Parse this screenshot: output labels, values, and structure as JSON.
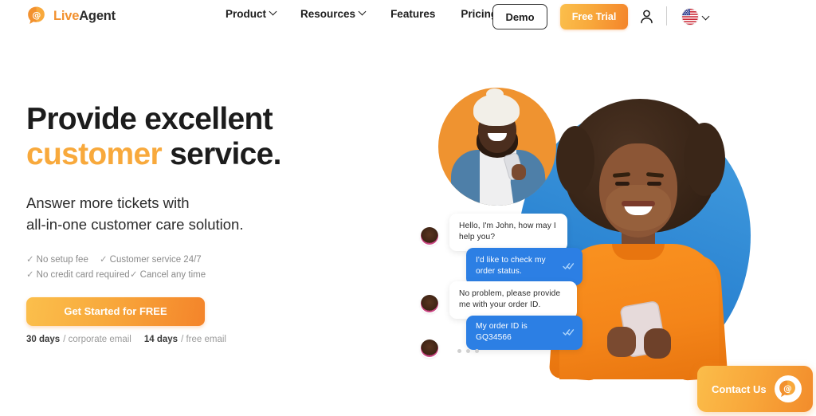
{
  "brand": {
    "logo_icon": "speech-bubble-at-icon",
    "name_part1": "Live",
    "name_part2": "Agent",
    "accent_orange": "#F2912F",
    "accent_dark": "#2b2b2b",
    "blue": "#2D86D3",
    "chat_blue": "#2C7FE4"
  },
  "header": {
    "nav": [
      {
        "label": "Product",
        "has_caret": true,
        "icon": "chevron-down-icon"
      },
      {
        "label": "Resources",
        "has_caret": true,
        "icon": "chevron-down-icon"
      },
      {
        "label": "Features",
        "has_caret": false,
        "icon": ""
      },
      {
        "label": "Pricing",
        "has_caret": false,
        "icon": ""
      }
    ],
    "demo_label": "Demo",
    "free_trial_label": "Free Trial",
    "account_icon": "user-account-icon",
    "language_icon": "us-flag-icon",
    "language_caret_icon": "chevron-down-icon"
  },
  "hero": {
    "headline_line1": "Provide excellent",
    "headline_accent": "customer",
    "headline_line2_rest": " service.",
    "subhead_line1": "Answer more tickets with",
    "subhead_line2": "all-in-one customer care solution.",
    "features": [
      {
        "check": "✓",
        "label": "No setup fee"
      },
      {
        "check": "✓",
        "label": "Customer service 24/7"
      },
      {
        "check": "✓",
        "label": "No credit card required"
      },
      {
        "check": "✓",
        "label": "Cancel any time"
      }
    ],
    "cta_label": "Get Started for FREE",
    "fineprint": {
      "days1": "30 days",
      "text1": "/ corporate email",
      "days2": "14 days",
      "text2": "/ free email"
    }
  },
  "chat": {
    "messages": [
      {
        "from": "agent",
        "text": "Hello, I'm John, how may I help you?",
        "ticks": false,
        "avatar": "agent-avatar"
      },
      {
        "from": "customer",
        "text": "I'd like to check my order status.",
        "ticks": true,
        "avatar": ""
      },
      {
        "from": "agent",
        "text": "No problem, please provide me with your order ID.",
        "ticks": false,
        "avatar": "agent-avatar"
      },
      {
        "from": "customer",
        "text": "My order ID is GQ34566",
        "ticks": true,
        "avatar": ""
      }
    ],
    "typing_indicator": "• • •"
  },
  "contact_widget": {
    "label": "Contact Us",
    "icon": "liveagent-speech-bubble-icon"
  }
}
